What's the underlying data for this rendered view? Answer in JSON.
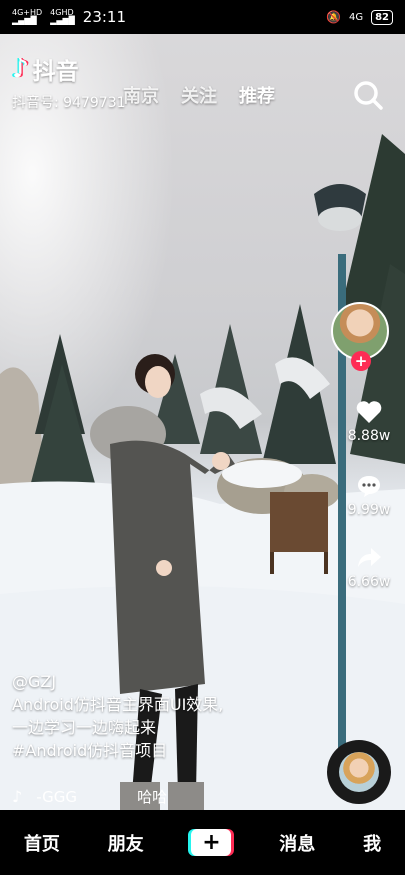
{
  "status": {
    "signal1": "4G+HD",
    "signal2": "4GHD",
    "time": "23:11",
    "net": "4G",
    "battery": "82"
  },
  "header": {
    "app_name": "抖音",
    "account_id": "抖音号: 9479731",
    "tabs": [
      "南京",
      "关注",
      "推荐"
    ]
  },
  "sidebar": {
    "likes": "8.88w",
    "comments": "9.99w",
    "shares": "6.66w"
  },
  "video": {
    "author": "@GZJ",
    "caption_line1": "Android仿抖音主界面UI效果,",
    "caption_line2": "一边学习一边嗨起来",
    "hashtag": "#Android仿抖音项目",
    "music": "-GGG",
    "music2": "哈哈"
  },
  "nav": {
    "home": "首页",
    "friends": "朋友",
    "create": "+",
    "messages": "消息",
    "me": "我"
  }
}
